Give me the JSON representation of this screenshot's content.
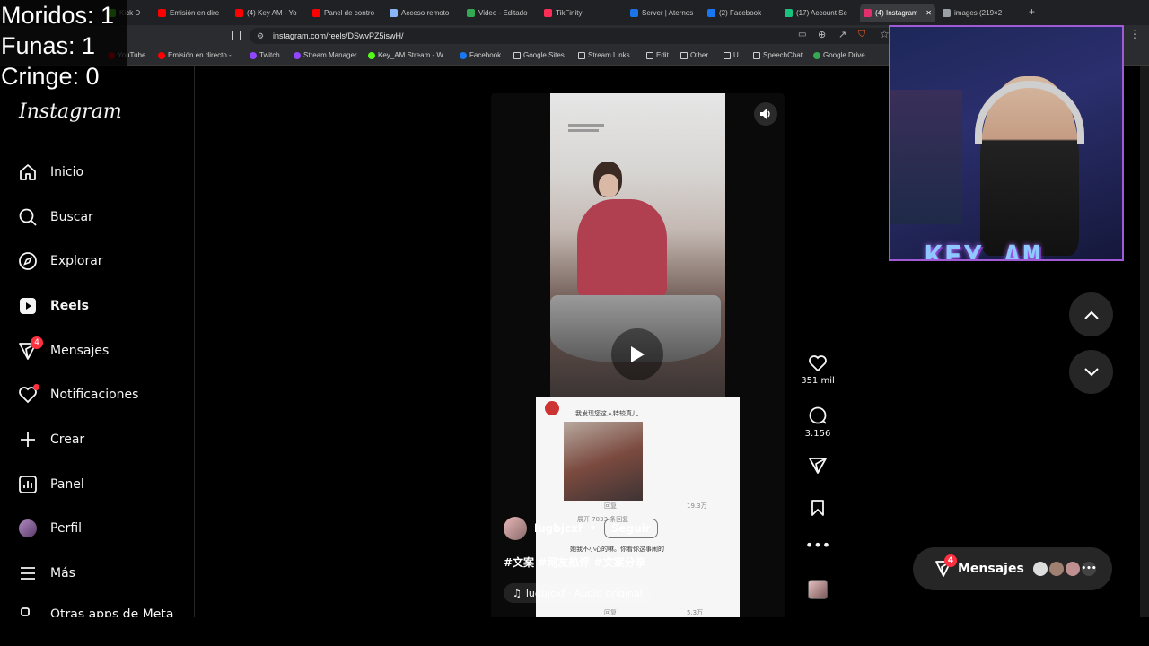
{
  "overlay": {
    "counters": [
      "Moridos: 1",
      "Funas: 1",
      "Cringe: 0"
    ]
  },
  "browser": {
    "tabs": [
      {
        "label": "Kick D",
        "color": "#53fc18"
      },
      {
        "label": "Emisión en dire",
        "color": "#ff0000"
      },
      {
        "label": "(4) Key AM - Yo",
        "color": "#ff0000"
      },
      {
        "label": "Panel de contro",
        "color": "#ff0000"
      },
      {
        "label": "Acceso remoto",
        "color": "#8ab4f8"
      },
      {
        "label": "Video - Editado",
        "color": "#34a853"
      },
      {
        "label": "TikFinity",
        "color": "#ff2d55"
      },
      {
        "label": "Server | Aternos",
        "color": "#1a73e8"
      },
      {
        "label": "(2) Facebook",
        "color": "#1877f2"
      },
      {
        "label": "(17) Account Se",
        "color": "#19c37d"
      },
      {
        "label": "(4) Instagram",
        "color": "#e1306c"
      },
      {
        "label": "images (219×2",
        "color": "#9aa0a6"
      }
    ],
    "url": "instagram.com/reels/DSwvPZ5iswH/",
    "bookmarks": [
      {
        "label": "YouTube",
        "color": "#ff0000"
      },
      {
        "label": "Emisión en directo -...",
        "color": "#ff0000"
      },
      {
        "label": "Twitch",
        "color": "#9146ff"
      },
      {
        "label": "Stream Manager",
        "color": "#9146ff"
      },
      {
        "label": "Key_AM Stream - W...",
        "color": "#53fc18"
      },
      {
        "label": "Facebook",
        "color": "#1877f2"
      },
      {
        "label": "Google Sites",
        "color": "#cfcfcf"
      },
      {
        "label": "Stream Links",
        "color": "#cfcfcf"
      },
      {
        "label": "Edit",
        "color": "#cfcfcf"
      },
      {
        "label": "Other",
        "color": "#cfcfcf"
      },
      {
        "label": "U",
        "color": "#cfcfcf"
      },
      {
        "label": "SpeechChat",
        "color": "#cfcfcf"
      },
      {
        "label": "Google Drive",
        "color": "#34a853"
      }
    ]
  },
  "sidebar": {
    "logo": "Instagram",
    "items": [
      {
        "label": "Inicio",
        "icon": "home-icon"
      },
      {
        "label": "Buscar",
        "icon": "search-icon"
      },
      {
        "label": "Explorar",
        "icon": "compass-icon"
      },
      {
        "label": "Reels",
        "icon": "reels-icon"
      },
      {
        "label": "Mensajes",
        "icon": "messenger-icon",
        "badge": "4"
      },
      {
        "label": "Notificaciones",
        "icon": "heart-icon"
      },
      {
        "label": "Crear",
        "icon": "plus-icon"
      },
      {
        "label": "Panel",
        "icon": "chart-icon"
      },
      {
        "label": "Perfil",
        "icon": "avatar-icon"
      },
      {
        "label": "Más",
        "icon": "menu-icon"
      },
      {
        "label": "Otras apps de Meta",
        "icon": "meta-icon"
      }
    ]
  },
  "reel": {
    "username": "lugbjcxf",
    "separator": "•",
    "follow": "Seguir",
    "hashtags": "#文案 #网友热评 #文案分享",
    "audio": "lugbjcxf · Audio original",
    "comment_card": {
      "line1": "我发现您这人特较真儿",
      "likes1": "19.3万",
      "reply": "展开 7833 条回复",
      "line2": "她我不小心的嘛。你看你这事闹的",
      "likes2": "5.3万",
      "reply_label": "回复"
    }
  },
  "actions": {
    "likes": "351 mil",
    "comments": "3.156"
  },
  "messages": {
    "label": "Mensajes",
    "badge": "4"
  },
  "stream": {
    "channel": "KEY_AM"
  }
}
